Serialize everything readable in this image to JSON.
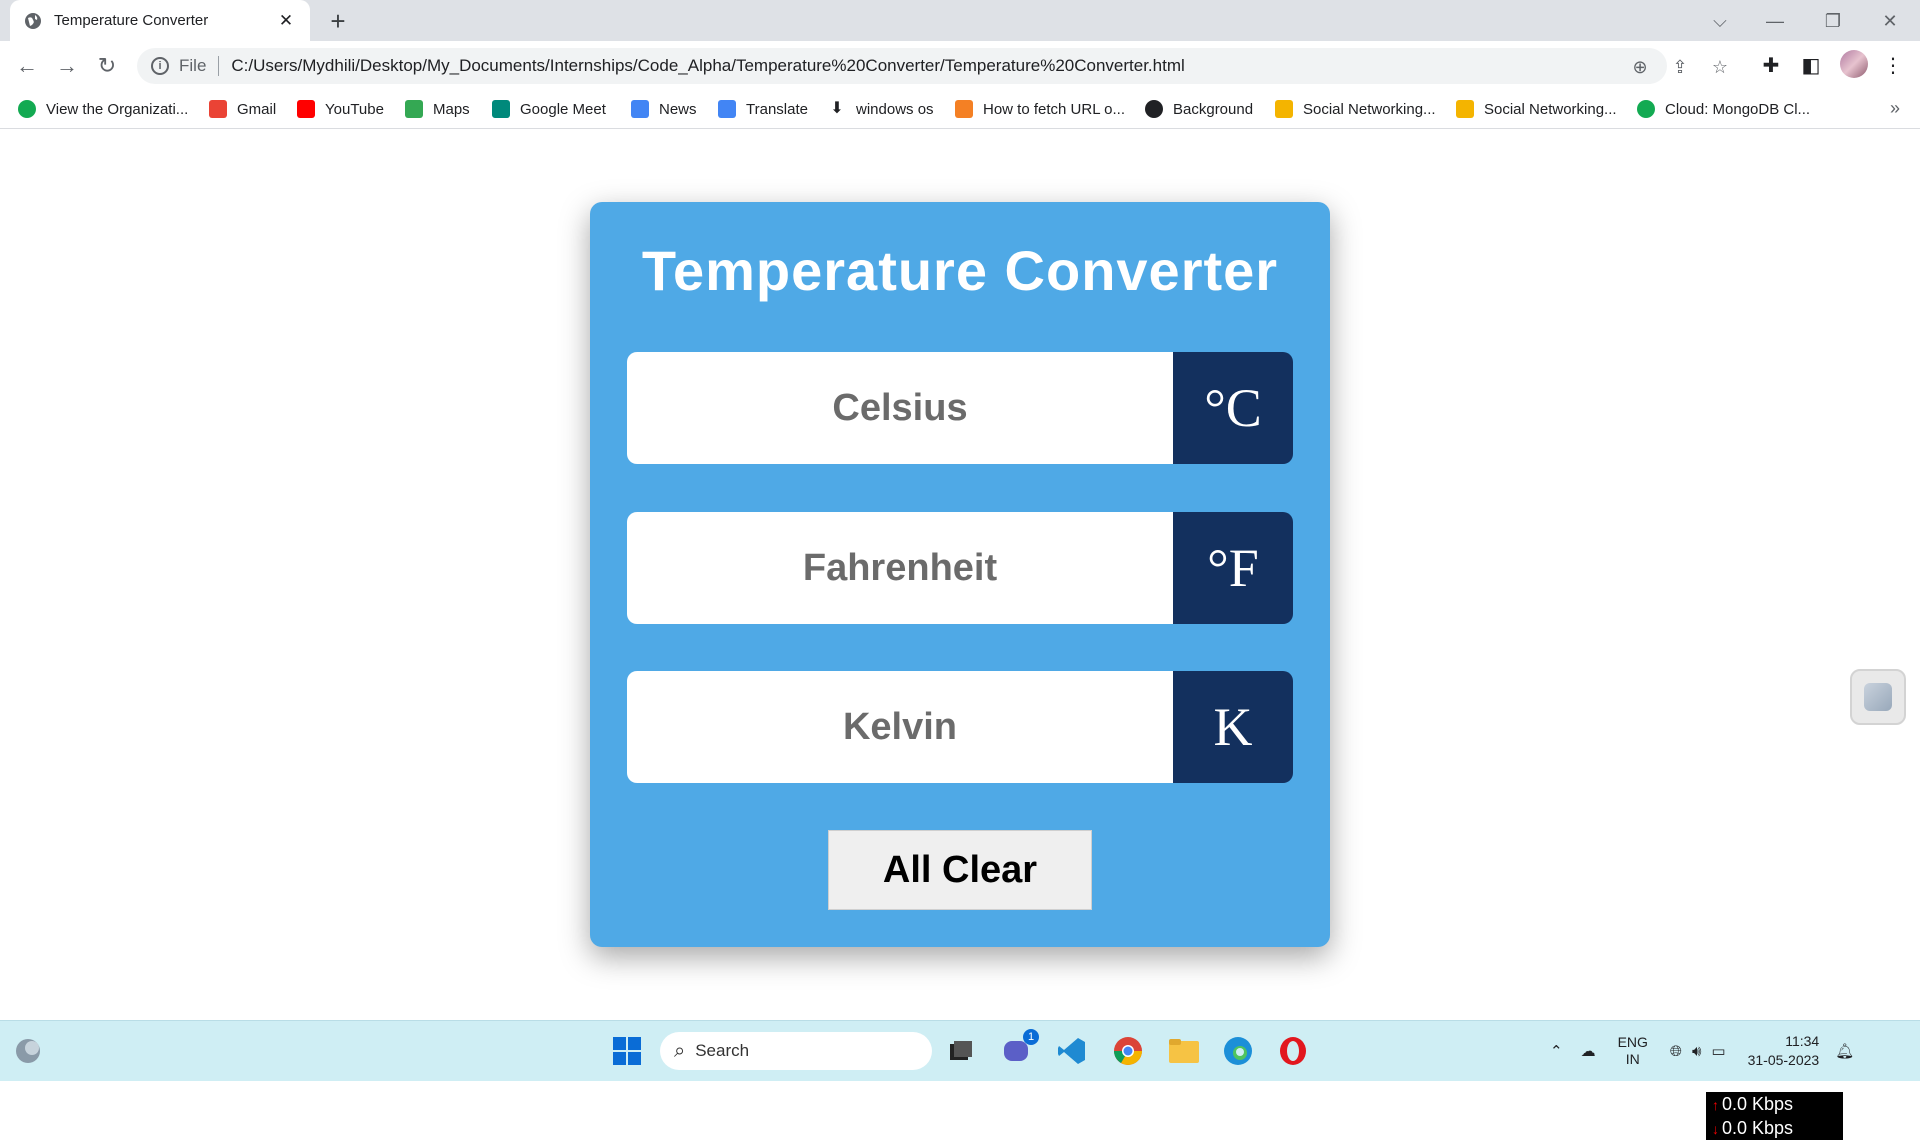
{
  "browser": {
    "tab_title": "Temperature Converter",
    "new_tab_symbol": "+",
    "omnibox_scheme": "File",
    "url": "C:/Users/Mydhili/Desktop/My_Documents/Internships/Code_Alpha/Temperature%20Converter/Temperature%20Converter.html"
  },
  "bookmarks": [
    {
      "label": "View the Organizati...",
      "icon": "mongodb-leaf-icon",
      "color": "#13aa52"
    },
    {
      "label": "Gmail",
      "icon": "gmail-icon",
      "color": "#ea4335"
    },
    {
      "label": "YouTube",
      "icon": "youtube-icon",
      "color": "#ff0000"
    },
    {
      "label": "Maps",
      "icon": "maps-icon",
      "color": "#34a853"
    },
    {
      "label": "Google Meet",
      "icon": "google-meet-icon",
      "color": "#00897b"
    },
    {
      "label": "News",
      "icon": "google-news-icon",
      "color": "#4285f4"
    },
    {
      "label": "Translate",
      "icon": "translate-icon",
      "color": "#4285f4"
    },
    {
      "label": "windows os",
      "icon": "download-icon",
      "color": "#202124"
    },
    {
      "label": "How to fetch URL o...",
      "icon": "stackoverflow-icon",
      "color": "#f48024"
    },
    {
      "label": "Background",
      "icon": "globe-icon",
      "color": "#202124"
    },
    {
      "label": "Social Networking...",
      "icon": "social-icon",
      "color": "#f4b400"
    },
    {
      "label": "Social Networking...",
      "icon": "social-icon",
      "color": "#f4b400"
    },
    {
      "label": "Cloud: MongoDB Cl...",
      "icon": "mongodb-leaf-icon",
      "color": "#13aa52"
    }
  ],
  "app": {
    "title": "Temperature Converter",
    "fields": [
      {
        "placeholder": "Celsius",
        "unit": "°C"
      },
      {
        "placeholder": "Fahrenheit",
        "unit": "°F"
      },
      {
        "placeholder": "Kelvin",
        "unit": "K"
      }
    ],
    "clear_label": "All Clear",
    "colors": {
      "card": "#4fa9e6",
      "unit_bg": "#13305e"
    }
  },
  "net_monitor": {
    "up": "0.0 Kbps",
    "down": "0.0 Kbps"
  },
  "taskbar": {
    "search_label": "Search",
    "teams_badge": "1",
    "lang_top": "ENG",
    "lang_bottom": "IN",
    "time": "11:34",
    "date": "31-05-2023"
  }
}
